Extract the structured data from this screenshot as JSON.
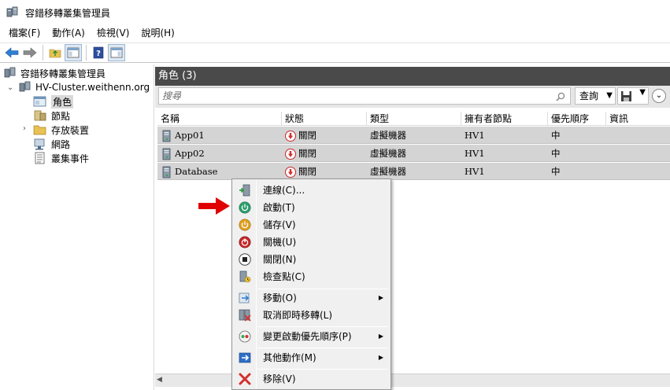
{
  "window": {
    "title": "容錯移轉叢集管理員"
  },
  "menu": [
    "檔案(F)",
    "動作(A)",
    "檢視(V)",
    "說明(H)"
  ],
  "tree": {
    "root": "容錯移轉叢集管理員",
    "cluster": "HV-Cluster.weithenn.org",
    "items": [
      {
        "label": "角色",
        "selected": true
      },
      {
        "label": "節點"
      },
      {
        "label": "存放裝置"
      },
      {
        "label": "網路"
      },
      {
        "label": "叢集事件"
      }
    ]
  },
  "panel": {
    "title": "角色 (3)",
    "search_placeholder": "搜尋",
    "query_label": "查詢"
  },
  "grid": {
    "columns": [
      "名稱",
      "狀態",
      "類型",
      "擁有者節點",
      "優先順序",
      "資訊"
    ],
    "rows": [
      {
        "name": "App01",
        "status": "關閉",
        "type": "虛擬機器",
        "owner": "HV1",
        "priority": "中"
      },
      {
        "name": "App02",
        "status": "關閉",
        "type": "虛擬機器",
        "owner": "HV1",
        "priority": "中"
      },
      {
        "name": "Database",
        "status": "關閉",
        "type": "虛擬機器",
        "owner": "HV1",
        "priority": "中"
      }
    ]
  },
  "context_menu": {
    "items": [
      {
        "label": "連線(C)...",
        "icon": "connect-icon"
      },
      {
        "label": "啟動(T)",
        "icon": "start-icon"
      },
      {
        "label": "儲存(V)",
        "icon": "save-state-icon"
      },
      {
        "label": "關機(U)",
        "icon": "shutdown-icon"
      },
      {
        "label": "關閉(N)",
        "icon": "turn-off-icon"
      },
      {
        "label": "檢查點(C)",
        "icon": "checkpoint-icon"
      },
      {
        "label": "移動(O)",
        "icon": "move-icon",
        "submenu": true
      },
      {
        "label": "取消即時移轉(L)",
        "icon": "cancel-migration-icon"
      },
      {
        "label": "變更啟動優先順序(P)",
        "icon": "priority-icon",
        "submenu": true
      },
      {
        "label": "其他動作(M)",
        "icon": "more-actions-icon",
        "submenu": true
      },
      {
        "label": "移除(V)",
        "icon": "remove-icon"
      }
    ]
  },
  "colors": {
    "header_bg": "#4a4a4a",
    "row_bg": "#d4d4d4",
    "arrow_red": "#e00000",
    "start_green": "#2e9e6e"
  }
}
